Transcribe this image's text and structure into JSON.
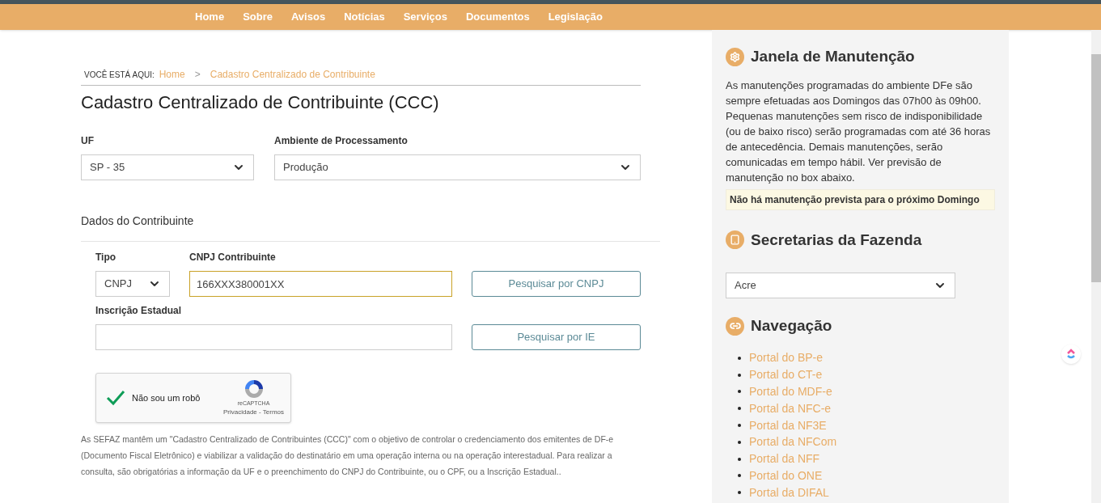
{
  "nav": {
    "items": [
      "Home",
      "Sobre",
      "Avisos",
      "Notícias",
      "Serviços",
      "Documentos",
      "Legislação"
    ]
  },
  "breadcrumb": {
    "label": "VOCÊ ESTÁ AQUI:",
    "items": [
      "Home",
      "Cadastro Centralizado de Contribuinte"
    ],
    "separator": ">"
  },
  "title": "Cadastro Centralizado de Contribuinte (CCC)",
  "uf": {
    "label": "UF",
    "value": "SP - 35"
  },
  "ambiente": {
    "label": "Ambiente de Processamento",
    "value": "Produção"
  },
  "section_title": "Dados do Contribuinte",
  "tipo": {
    "label": "Tipo",
    "value": "CNPJ"
  },
  "cnpj": {
    "label": "CNPJ Contribuinte",
    "value": "166XXX380001XX"
  },
  "ie": {
    "label": "Inscrição Estadual"
  },
  "buttons": [
    "Pesquisar por CNPJ",
    "Pesquisar por IE"
  ],
  "captcha": {
    "label": "Não sou um robô",
    "checked": true,
    "brand": "reCAPTCHA",
    "links": "Privacidade - Termos"
  },
  "description": "As SEFAZ mantêm um \"Cadastro Centralizado de Contribuintes (CCC)\" com o objetivo de controlar o credenciamento dos emitentes de DF-e (Documento Fiscal Eletrônico) e viabilizar a validação do destinatário em uma operação interna ou na operação interestadual. Para realizar a consulta, são obrigatórias a informação da UF e o preenchimento do CNPJ do Contribuinte, ou o CPF, ou a Inscrição Estadual..",
  "sidebar": {
    "maintenance": {
      "title": "Janela de Manutenção",
      "text": "As manutenções programadas do ambiente DFe são sempre efetuadas aos Domingos das 07h00 às 09h00. Pequenas manutenções sem risco de indisponibilidade (ou de baixo risco) serão programadas com até 36 horas de antecedência. Demais manutenções, serão comunicadas em tempo hábil. Ver previsão de manutenção no box abaixo.",
      "notice": "Não há manutenção prevista para o próximo Domingo"
    },
    "secretarias": {
      "title": "Secretarias da Fazenda",
      "value": "Acre"
    },
    "navegacao": {
      "title": "Navegação",
      "links": [
        "Portal do BP-e",
        "Portal do CT-e",
        "Portal do MDF-e",
        "Portal da NFC-e",
        "Portal da NF3E",
        "Portal da NFCom",
        "Portal da NFF",
        "Portal do ONE",
        "Portal da DIFAL"
      ]
    }
  }
}
